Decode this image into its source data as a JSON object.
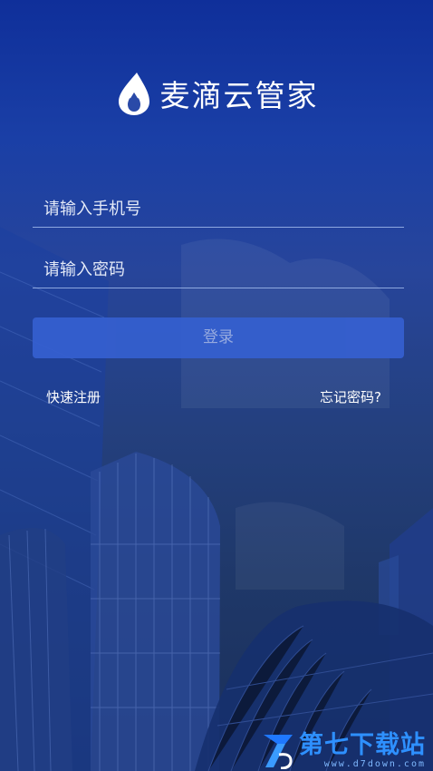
{
  "app": {
    "title": "麦滴云管家"
  },
  "form": {
    "phone_placeholder": "请输入手机号",
    "password_placeholder": "请输入密码",
    "login_label": "登录"
  },
  "links": {
    "register": "快速注册",
    "forgot": "忘记密码?"
  },
  "watermark": {
    "title": "第七下载站",
    "url": "www.d7down.com"
  },
  "colors": {
    "background_top": "#0f2f9a",
    "background_bottom": "#1a2f59",
    "button": "#3560d0",
    "watermark": "#2e90ff"
  }
}
